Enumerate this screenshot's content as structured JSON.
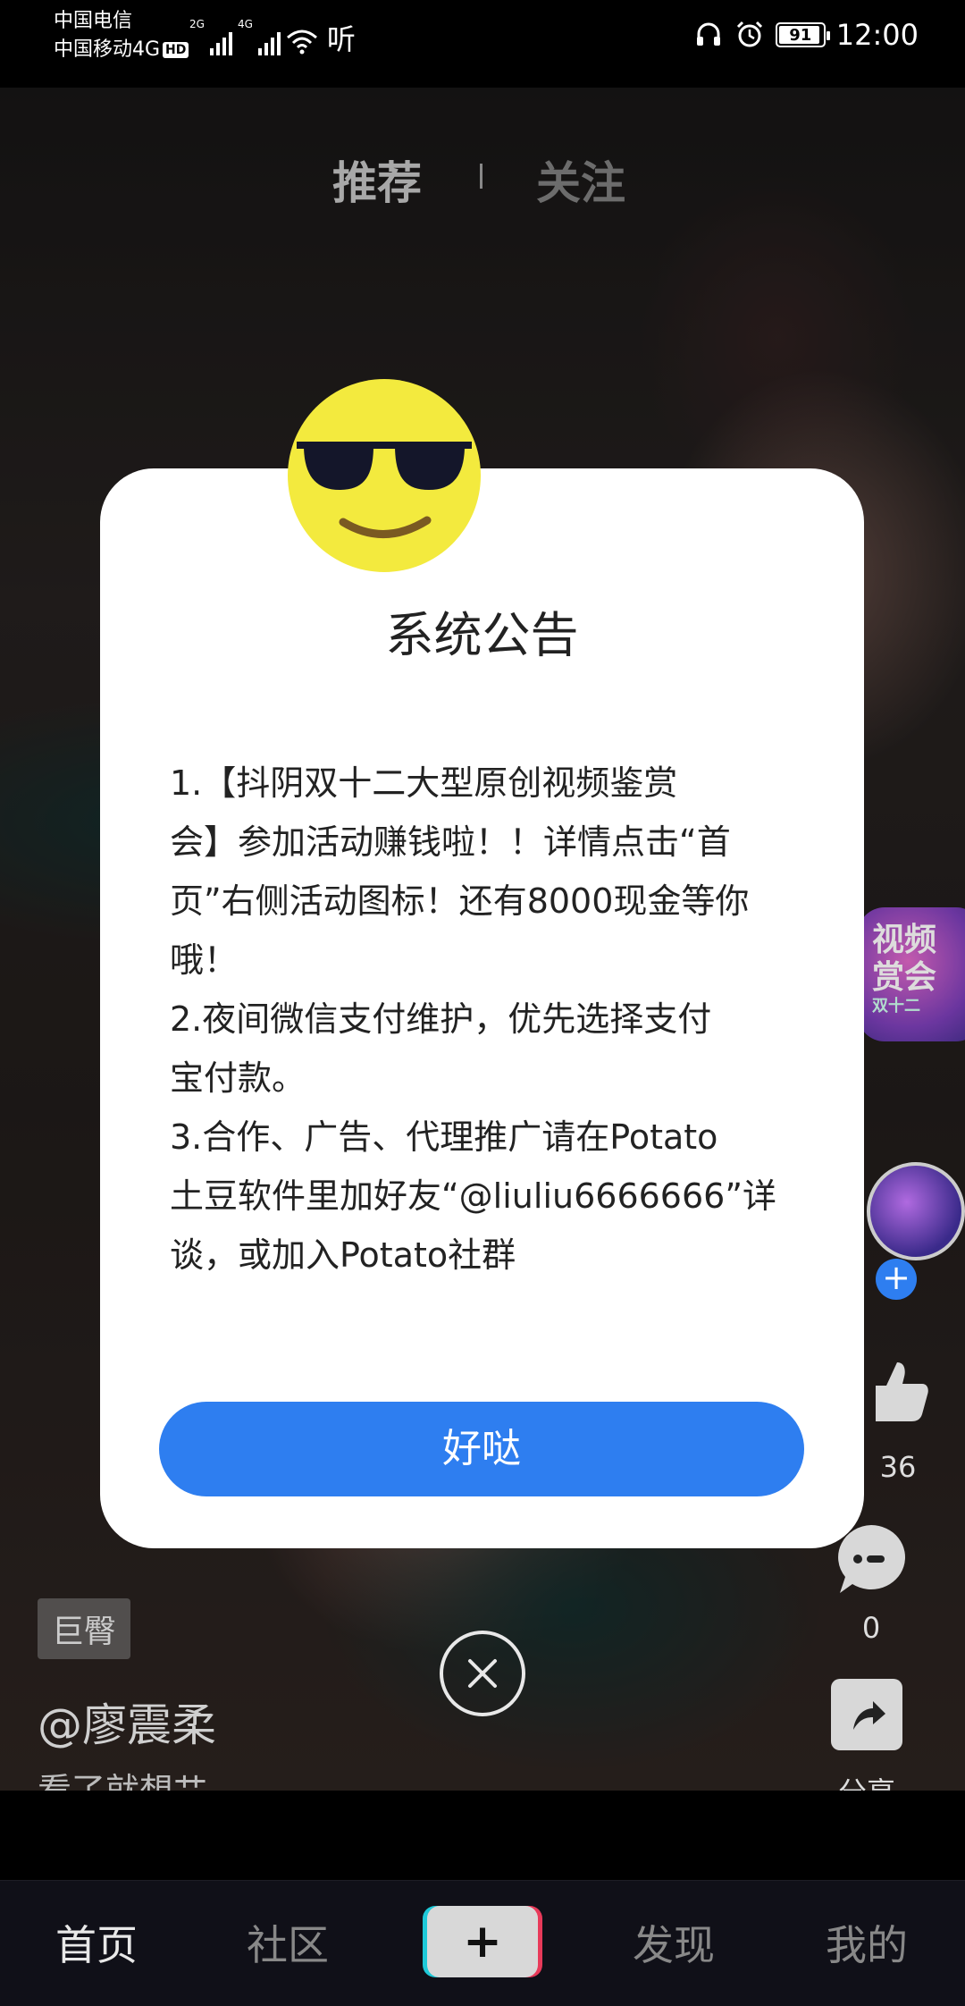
{
  "status_bar": {
    "carrier_1": "中国电信",
    "carrier_2": "中国移动4G",
    "hd_badge": "HD",
    "net_1": "2G",
    "net_2": "4G",
    "ting": "听",
    "battery": "91",
    "time": "12:00"
  },
  "top_tabs": {
    "recommend": "推荐",
    "follow": "关注"
  },
  "modal": {
    "title": "系统公告",
    "body": "1.【抖阴双十二大型原创视频鉴赏\n会】参加活动赚钱啦！！详情点击“首\n页”右侧活动图标！还有8000现金等你\n哦！\n2.夜间微信支付维护，优先选择支付\n宝付款。\n3.合作、广告、代理推广请在Potato\n土豆软件里加好友“@liuliu6666666”详\n谈，或加入Potato社群",
    "ok_button": "好哒"
  },
  "video": {
    "tag": "巨臀",
    "author": "@廖震柔",
    "caption": "看了就想艹"
  },
  "rail": {
    "event_badge_line1": "视频",
    "event_badge_line2": "赏会",
    "event_badge_line3": "双十二",
    "like_count": "36",
    "comment_count": "0",
    "share_label": "分享"
  },
  "bottom_nav": {
    "home": "首页",
    "community": "社区",
    "create": "+",
    "discover": "发现",
    "mine": "我的"
  },
  "colors": {
    "accent_blue": "#2e7ef0",
    "emoji_yellow": "#f3ea3e",
    "nav_bg": "#101018"
  }
}
